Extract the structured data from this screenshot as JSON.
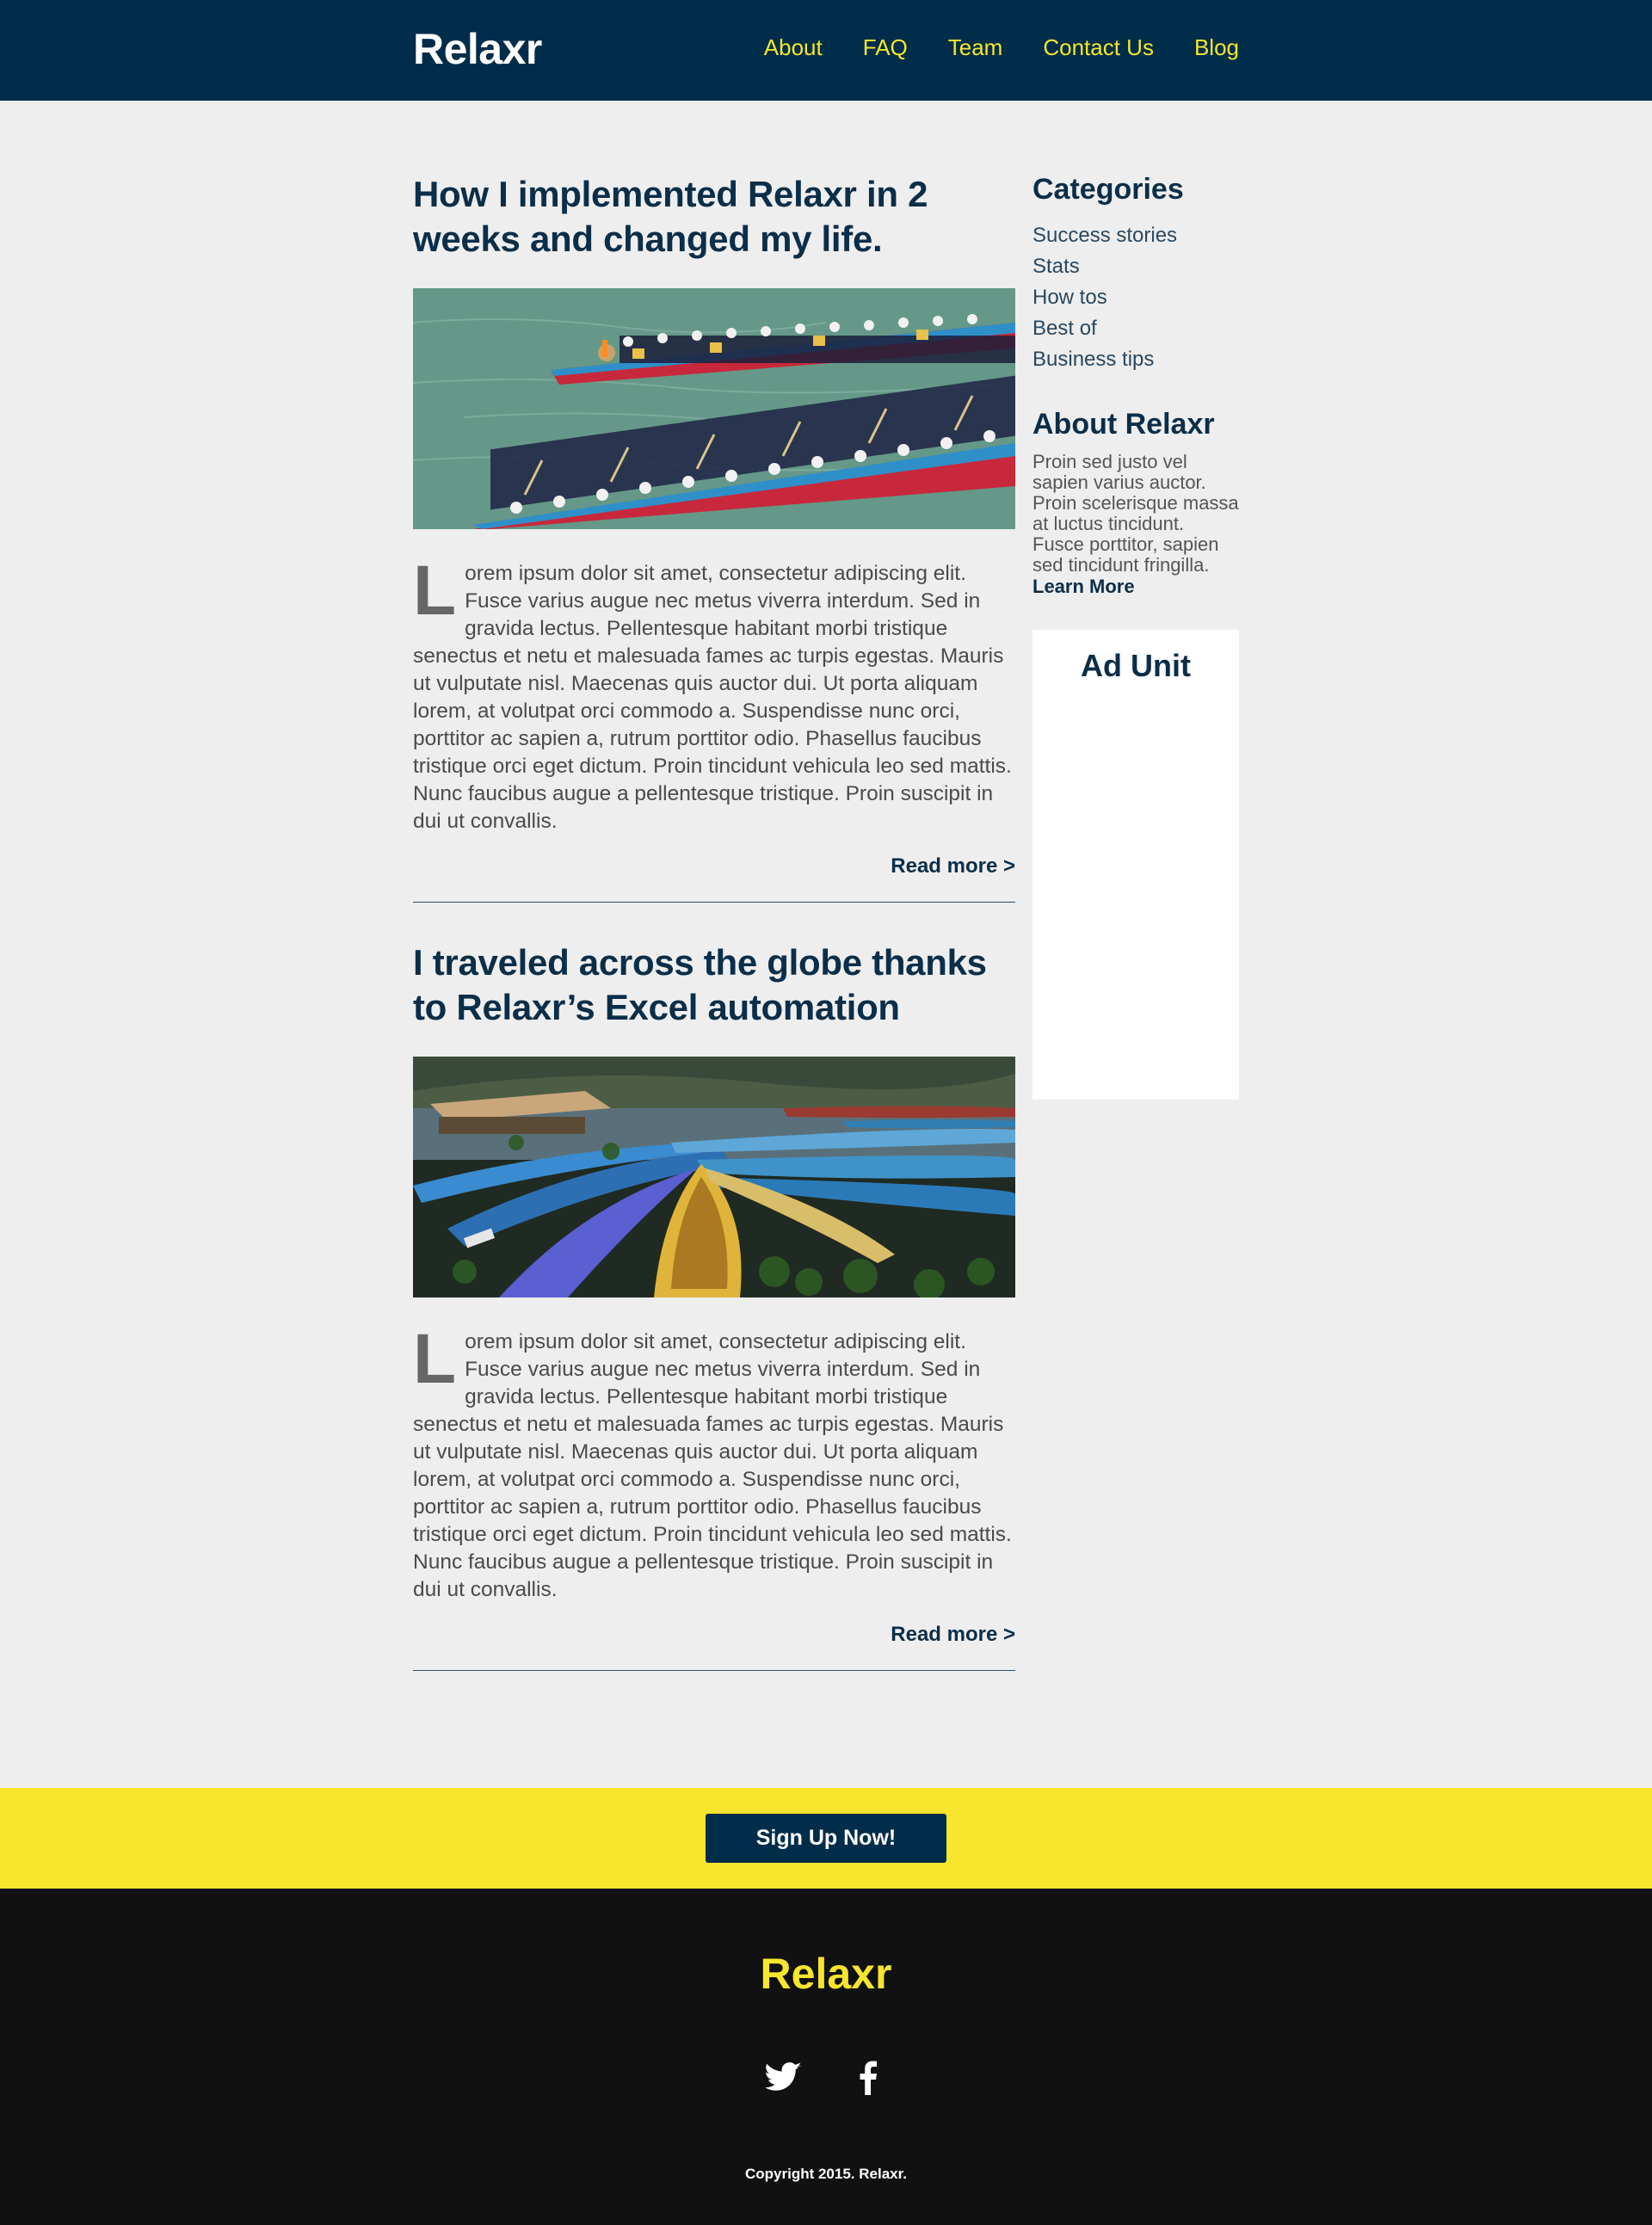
{
  "header": {
    "logo": "Relaxr",
    "nav": [
      "About",
      "FAQ",
      "Team",
      "Contact Us",
      "Blog"
    ]
  },
  "posts": [
    {
      "title": "How I implemented Relaxr in 2 weeks and changed my life.",
      "dropcap": "L",
      "body": "orem ipsum dolor sit amet, consectetur adipiscing elit. Fusce varius augue nec metus viverra interdum. Sed in gravida lectus. Pellentesque habitant morbi tristique senectus et netu et malesuada fames ac turpis egestas. Mauris ut vulputate nisl. Maecenas quis auctor dui. Ut porta aliquam lorem, at volutpat orci commodo a. Suspendisse nunc orci, porttitor ac sapien a, rutrum porttitor odio. Phasellus faucibus tristique orci eget dictum. Proin tincidunt vehicula leo sed mattis. Nunc faucibus augue a pellentesque tristique. Proin suscipit in dui ut convallis.",
      "read_more": "Read more >"
    },
    {
      "title": "I traveled across the globe thanks to Relaxr’s Excel automation",
      "dropcap": "L",
      "body": "orem ipsum dolor sit amet, consectetur adipiscing elit. Fusce varius augue nec metus viverra interdum. Sed in gravida lectus. Pellentesque habitant morbi tristique senectus et netu et malesuada fames ac turpis egestas. Mauris ut vulputate nisl. Maecenas quis auctor dui. Ut porta aliquam lorem, at volutpat orci commodo a. Suspendisse nunc orci, porttitor ac sapien a, rutrum porttitor odio. Phasellus faucibus tristique orci eget dictum. Proin tincidunt vehicula leo sed mattis. Nunc faucibus augue a pellentesque tristique. Proin suscipit in dui ut convallis.",
      "read_more": "Read more >"
    }
  ],
  "sidebar": {
    "categories_heading": "Categories",
    "categories": [
      "Success stories",
      "Stats",
      "How tos",
      "Best of",
      "Business tips"
    ],
    "about_heading": "About Relaxr",
    "about_text": "Proin sed justo vel sapien varius auctor. Proin scelerisque massa at luctus tincidunt. Fusce porttitor, sapien sed tincidunt fringilla.",
    "learn_more": "Learn More",
    "ad_title": "Ad Unit"
  },
  "cta": {
    "button": "Sign Up Now!"
  },
  "footer": {
    "logo": "Relaxr",
    "social_icons": [
      "twitter-icon",
      "facebook-icon"
    ],
    "copyright": "Copyright 2015. Relaxr."
  },
  "colors": {
    "navy": "#002d4a",
    "yellow": "#f7e52e",
    "background": "#eeeeee",
    "footer": "#111111"
  }
}
